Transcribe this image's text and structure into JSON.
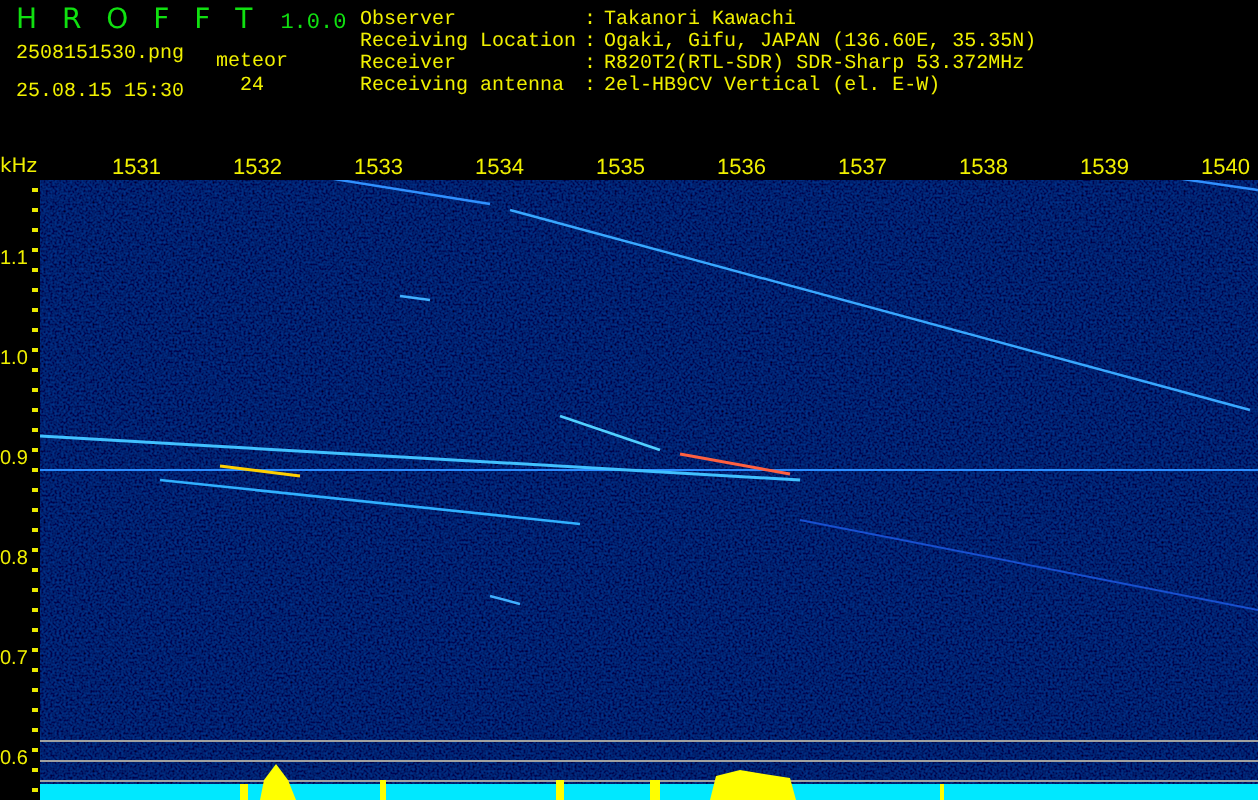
{
  "app": {
    "title": "H R O F F T",
    "version": "1.0.0",
    "file_name": "2508151530.png",
    "timestamp": "25.08.15 15:30",
    "count_label": "meteor",
    "count_value": "24"
  },
  "station_info": [
    {
      "label": "Observer",
      "separator": ":",
      "value": "Takanori Kawachi"
    },
    {
      "label": "Receiving Location",
      "separator": ":",
      "value": "Ogaki, Gifu, JAPAN (136.60E, 35.35N)"
    },
    {
      "label": "Receiver",
      "separator": ":",
      "value": "R820T2(RTL-SDR) SDR-Sharp 53.372MHz"
    },
    {
      "label": "Receiving antenna",
      "separator": ":",
      "value": "2el-HB9CV Vertical (el. E-W)"
    }
  ],
  "spectrogram": {
    "unit": "kHz",
    "x_labels": [
      "1531",
      "1532",
      "1533",
      "1534",
      "1535",
      "1536",
      "1537",
      "1538",
      "1539",
      "1540"
    ],
    "y_labels": [
      "1.1",
      "1.0",
      "0.9",
      "0.8",
      "0.7",
      "0.6"
    ]
  }
}
